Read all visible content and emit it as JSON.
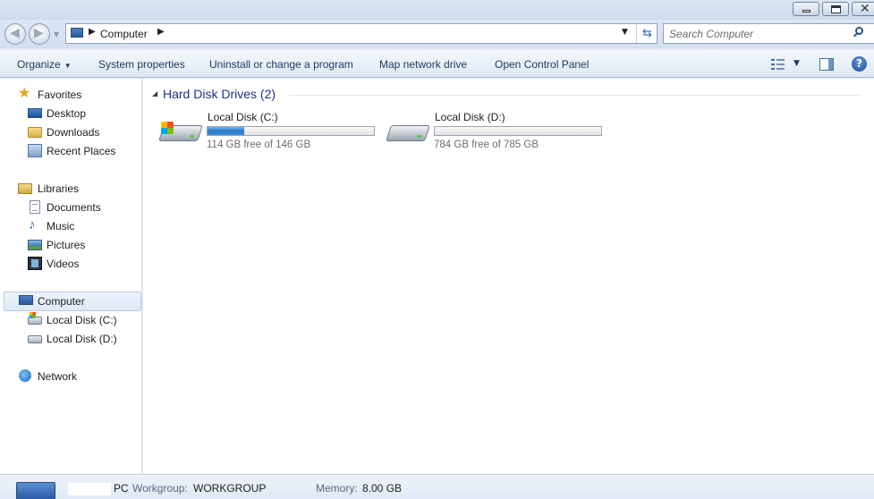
{
  "window": {
    "close_glyph": "✕"
  },
  "address_bar": {
    "path_segments": [
      "Computer"
    ],
    "search_placeholder": "Search Computer"
  },
  "command_bar": {
    "organize": "Organize",
    "system_properties": "System properties",
    "uninstall": "Uninstall or change a program",
    "map_network_drive": "Map network drive",
    "open_control_panel": "Open Control Panel"
  },
  "nav_pane": {
    "favorites": {
      "label": "Favorites",
      "items": [
        {
          "label": "Desktop",
          "icon": "desktop-icon"
        },
        {
          "label": "Downloads",
          "icon": "downloads-icon"
        },
        {
          "label": "Recent Places",
          "icon": "recent-places-icon"
        }
      ]
    },
    "libraries": {
      "label": "Libraries",
      "items": [
        {
          "label": "Documents",
          "icon": "documents-icon"
        },
        {
          "label": "Music",
          "icon": "music-icon"
        },
        {
          "label": "Pictures",
          "icon": "pictures-icon"
        },
        {
          "label": "Videos",
          "icon": "videos-icon"
        }
      ]
    },
    "computer": {
      "label": "Computer",
      "items": [
        {
          "label": "Local Disk (C:)",
          "icon": "windows-drive-icon"
        },
        {
          "label": "Local Disk (D:)",
          "icon": "drive-icon"
        }
      ]
    },
    "network": {
      "label": "Network"
    }
  },
  "content": {
    "group_title": "Hard Disk Drives (2)",
    "drives": [
      {
        "name": "Local Disk (C:)",
        "free_text": "114 GB free of 146 GB",
        "used_fraction": 0.22,
        "icon": "windows-system-drive-icon"
      },
      {
        "name": "Local Disk (D:)",
        "free_text": "784 GB free of 785 GB",
        "used_fraction": 0.0,
        "icon": "hard-drive-icon"
      }
    ]
  },
  "details_pane": {
    "computer_name_suffix": "PC",
    "workgroup_label": "Workgroup:",
    "workgroup_value": "WORKGROUP",
    "memory_label": "Memory:",
    "memory_value": "8.00 GB"
  },
  "colors": {
    "accent": "#1e3287",
    "bar_fill": "#2a78c9",
    "chrome": "#dfe9f5"
  }
}
